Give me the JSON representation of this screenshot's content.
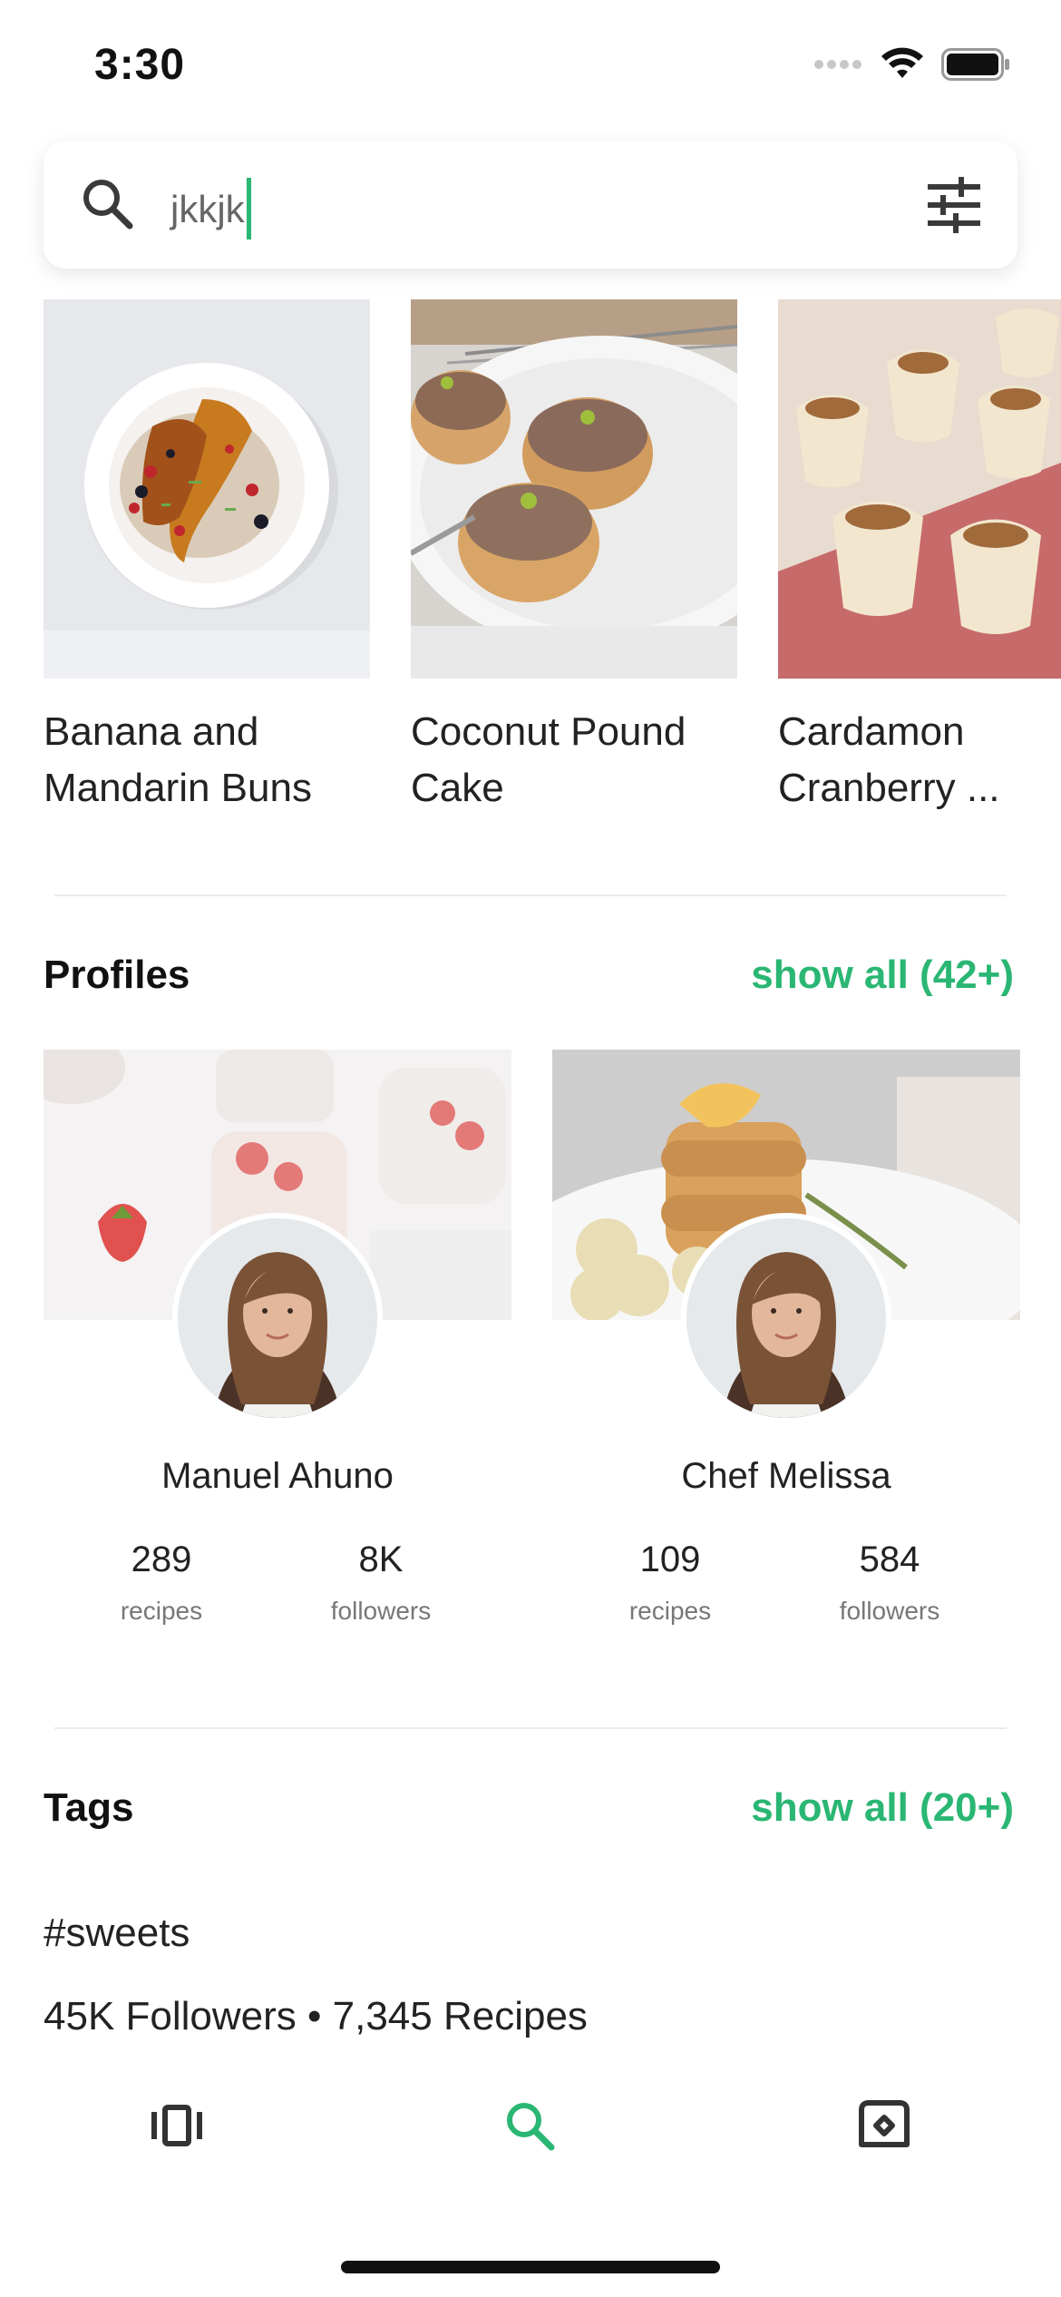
{
  "status_bar": {
    "time": "3:30"
  },
  "search": {
    "query": "jkkjk"
  },
  "recipes": [
    {
      "title": "Banana and Mandarin Buns"
    },
    {
      "title": "Coconut Pound Cake"
    },
    {
      "title": "Cardamon Cranberry ..."
    }
  ],
  "profiles_section": {
    "title": "Profiles",
    "show_all": "show all (42+)"
  },
  "profiles": [
    {
      "name": "Manuel Ahuno",
      "recipes_count": "289",
      "recipes_label": "recipes",
      "followers_count": "8K",
      "followers_label": "followers"
    },
    {
      "name": "Chef Melissa",
      "recipes_count": "109",
      "recipes_label": "recipes",
      "followers_count": "584",
      "followers_label": "followers"
    }
  ],
  "tags_section": {
    "title": "Tags",
    "show_all": "show all (20+)"
  },
  "tag": {
    "name": "#sweets",
    "meta": "45K Followers • 7,345 Recipes"
  },
  "bottom_nav": {
    "active": "search"
  },
  "colors": {
    "accent": "#2ab673",
    "text": "#1f1f1f",
    "muted": "#777777"
  }
}
